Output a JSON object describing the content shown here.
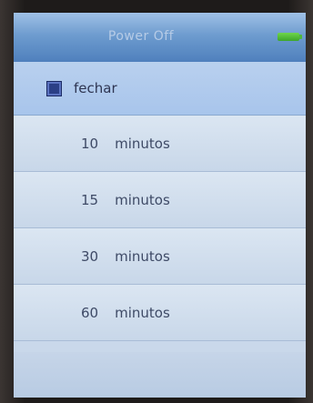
{
  "header": {
    "title": "Power Off",
    "battery_icon": "battery-full-icon",
    "battery_color": "#4fb83a"
  },
  "options": [
    {
      "number": "",
      "label": "fechar",
      "selected": true
    },
    {
      "number": "10",
      "label": "minutos",
      "selected": false
    },
    {
      "number": "15",
      "label": "minutos",
      "selected": false
    },
    {
      "number": "30",
      "label": "minutos",
      "selected": false
    },
    {
      "number": "60",
      "label": "minutos",
      "selected": false
    }
  ],
  "colors": {
    "header_blue": "#5f8fc8",
    "selected_row": "#b0caed",
    "checkbox": "#2b3f86"
  }
}
